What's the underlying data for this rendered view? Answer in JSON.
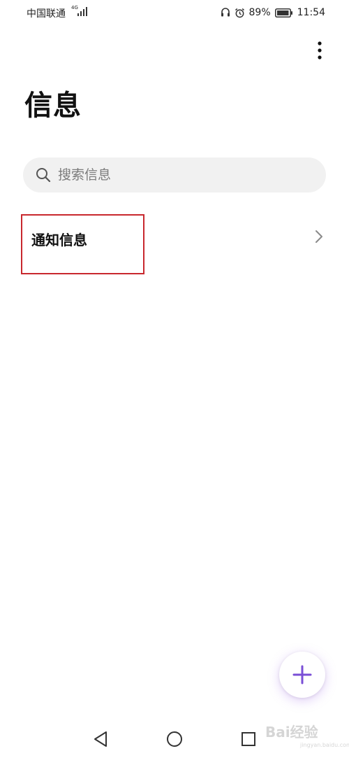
{
  "status_bar": {
    "carrier": "中国联通",
    "network_type": "4G",
    "battery_percent": "89%",
    "time": "11:54",
    "icons": [
      "signal-icon",
      "headset-icon",
      "alarm-icon",
      "battery-icon"
    ]
  },
  "header": {
    "title": "信息",
    "more_icon": "more-vertical-icon"
  },
  "search": {
    "placeholder": "搜索信息",
    "icon": "search-icon"
  },
  "list": {
    "items": [
      {
        "label": "通知信息",
        "icon": "chevron-right-icon"
      }
    ]
  },
  "fab": {
    "icon": "plus-icon",
    "accent": "#7a4fd6"
  },
  "nav": {
    "icons": [
      "back-icon",
      "home-icon",
      "recent-apps-icon"
    ]
  },
  "watermark": {
    "text": "Bai经验",
    "subtext": "jingyan.baidu.com"
  },
  "colors": {
    "highlight_border": "#c8282e",
    "search_background": "#f1f1f1"
  }
}
